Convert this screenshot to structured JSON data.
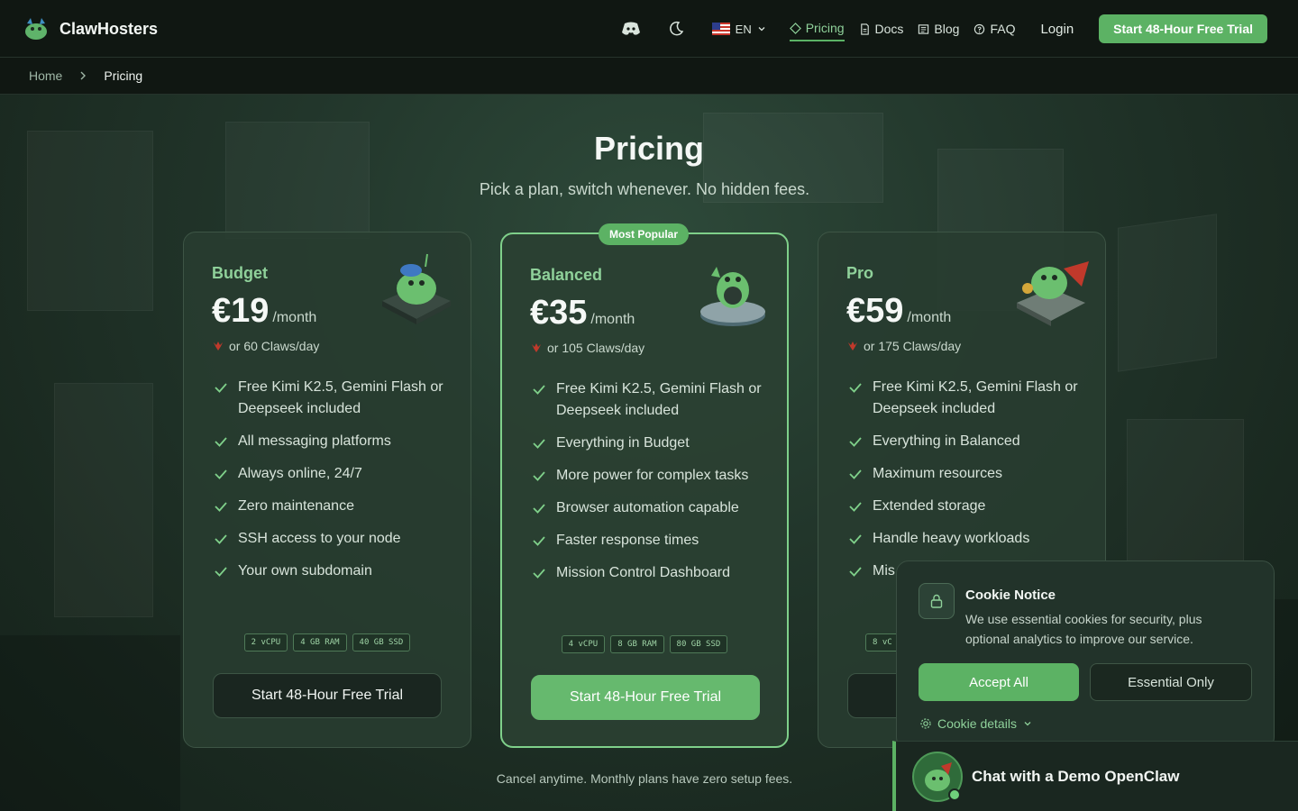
{
  "header": {
    "brand": "ClawHosters",
    "lang": "EN",
    "nav": [
      {
        "label": "Pricing",
        "icon": "tag-icon",
        "active": true
      },
      {
        "label": "Docs",
        "icon": "document-icon"
      },
      {
        "label": "Blog",
        "icon": "newspaper-icon"
      },
      {
        "label": "FAQ",
        "icon": "question-icon"
      }
    ],
    "login": "Login",
    "cta": "Start 48-Hour Free Trial"
  },
  "breadcrumb": {
    "home": "Home",
    "current": "Pricing"
  },
  "hero": {
    "title": "Pricing",
    "subtitle": "Pick a plan, switch whenever. No hidden fees."
  },
  "plans": [
    {
      "name": "Budget",
      "price": "€19",
      "period": "/month",
      "claws": "or 60 Claws/day",
      "features": [
        "Free Kimi K2.5, Gemini Flash or Deepseek included",
        "All messaging platforms",
        "Always online, 24/7",
        "Zero maintenance",
        "SSH access to your node",
        "Your own subdomain"
      ],
      "specs": [
        "2 vCPU",
        "4 GB RAM",
        "40 GB SSD"
      ],
      "button": "Start 48-Hour Free Trial"
    },
    {
      "name": "Balanced",
      "badge": "Most Popular",
      "price": "€35",
      "period": "/month",
      "claws": "or 105 Claws/day",
      "features": [
        "Free Kimi K2.5, Gemini Flash or Deepseek included",
        "Everything in Budget",
        "More power for complex tasks",
        "Browser automation capable",
        "Faster response times",
        "Mission Control Dashboard"
      ],
      "specs": [
        "4 vCPU",
        "8 GB RAM",
        "80 GB SSD"
      ],
      "button": "Start 48-Hour Free Trial"
    },
    {
      "name": "Pro",
      "price": "€59",
      "period": "/month",
      "claws": "or 175 Claws/day",
      "features": [
        "Free Kimi K2.5, Gemini Flash or Deepseek included",
        "Everything in Balanced",
        "Maximum resources",
        "Extended storage",
        "Handle heavy workloads",
        "Mis"
      ],
      "specs": [
        "8 vC"
      ],
      "button": ""
    }
  ],
  "footnote": "Cancel anytime. Monthly plans have zero setup fees.",
  "cookie": {
    "title": "Cookie Notice",
    "text": "We use essential cookies for security, plus optional analytics to improve our service.",
    "accept": "Accept All",
    "essential": "Essential Only",
    "details": "Cookie details"
  },
  "chat": {
    "label": "Chat with a Demo OpenClaw"
  },
  "colors": {
    "accent": "#5cb264",
    "accent_light": "#8fd19a",
    "header_bg": "#101712"
  }
}
